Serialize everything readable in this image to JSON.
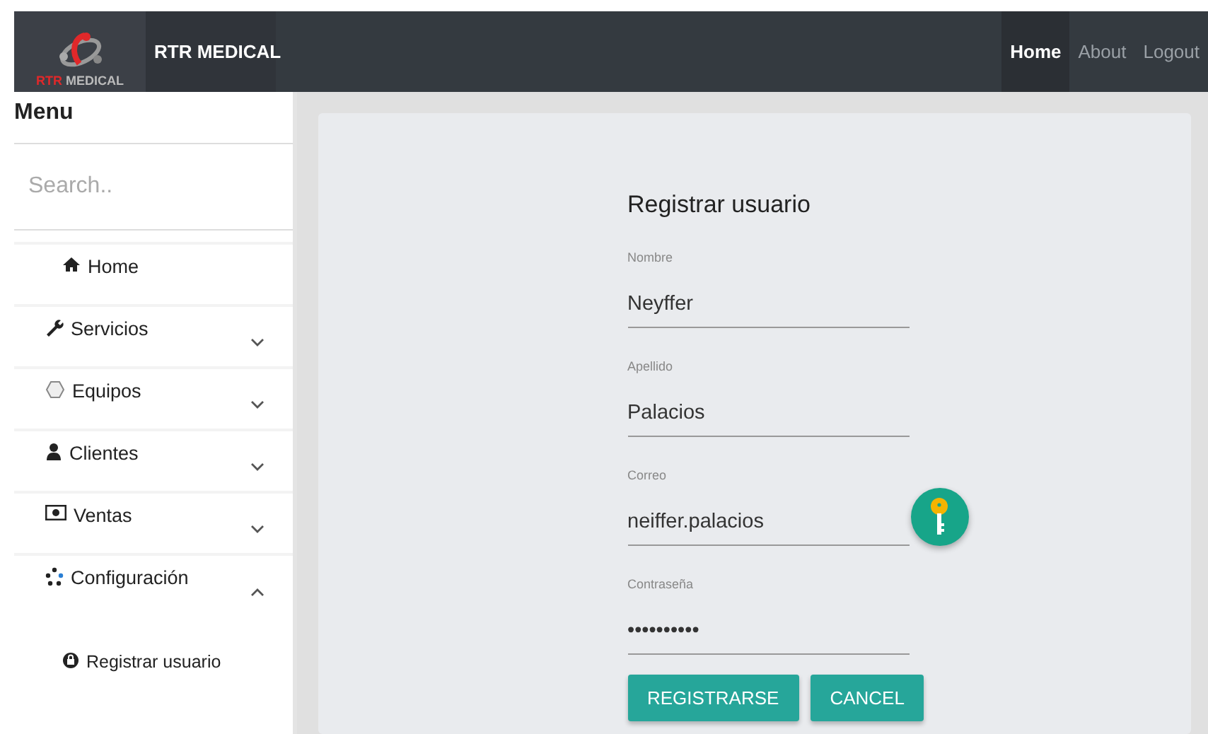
{
  "navbar": {
    "logo_text": {
      "red": "RTR",
      "grey": "MEDICAL"
    },
    "brand": "RTR MEDICAL",
    "links": [
      {
        "label": "Home",
        "selected": true
      },
      {
        "label": "About",
        "selected": false
      },
      {
        "label": "Logout",
        "selected": false
      }
    ]
  },
  "sidebar": {
    "title": "Menu",
    "search": {
      "placeholder": "Search.."
    },
    "items": [
      {
        "label": "Home",
        "kind": "link"
      },
      {
        "label": "Servicios",
        "kind": "group",
        "expanded": false
      },
      {
        "label": "Equipos",
        "kind": "group",
        "expanded": false
      },
      {
        "label": "Clientes",
        "kind": "group",
        "expanded": false
      },
      {
        "label": "Ventas",
        "kind": "group",
        "expanded": false
      },
      {
        "label": "Configuración",
        "kind": "group",
        "expanded": true,
        "children": [
          {
            "label": "Registrar usuario"
          }
        ]
      }
    ]
  },
  "form": {
    "title": "Registrar usuario",
    "fields": [
      {
        "label": "Nombre",
        "value": "Neyffer"
      },
      {
        "label": "Apellido",
        "value": "Palacios"
      },
      {
        "label": "Correo",
        "value": "neiffer.palacios"
      },
      {
        "label": "Contraseña",
        "value": "••••••••••"
      }
    ],
    "buttons": [
      "REGISTRARSE",
      "CANCEL"
    ]
  }
}
